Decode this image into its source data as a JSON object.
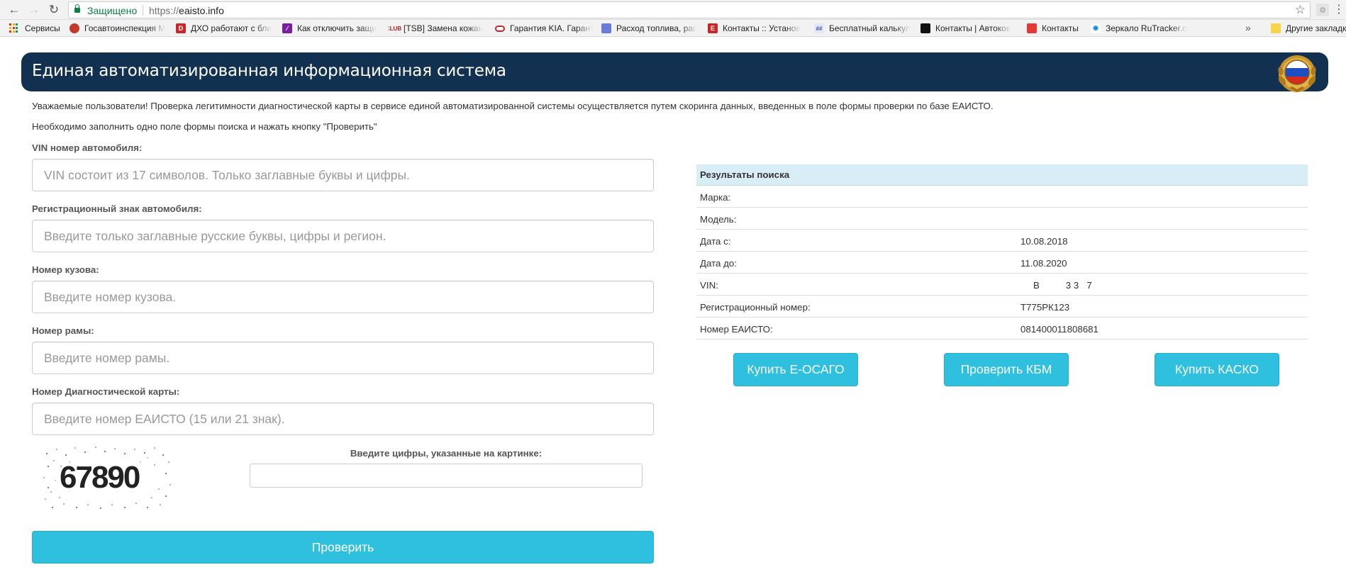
{
  "browser": {
    "secure_label": "Защищено",
    "url_scheme": "https://",
    "url_host": "eaisto.info",
    "bookmarks": [
      {
        "label": "Сервисы",
        "icon": "apps-grid-icon"
      },
      {
        "label": "Госавтоинспекция М",
        "icon": "gibdd-emblem-icon"
      },
      {
        "label": "ДХО работают с бли",
        "icon": "d-letter-icon"
      },
      {
        "label": "Как отключить защи",
        "icon": "purple-square-icon"
      },
      {
        "label": "[TSB] Замена кожан",
        "icon": "tsb-club-icon"
      },
      {
        "label": "Гарантия KIA. Гарант",
        "icon": "kia-logo-icon"
      },
      {
        "label": "Расход топлива, рас",
        "icon": "blue-doc-icon"
      },
      {
        "label": "Контакты :: Установ",
        "icon": "e-letter-icon"
      },
      {
        "label": "Бесплатный калькул",
        "icon": "calc-icon"
      },
      {
        "label": "Контакты | Автоков",
        "icon": "black-square-icon"
      },
      {
        "label": "Контакты",
        "icon": "red-logo-icon"
      },
      {
        "label": "Зеркало RuTracker.o",
        "icon": "rutracker-icon"
      },
      {
        "label": "Другие закладк",
        "icon": "folder-icon"
      }
    ]
  },
  "header": {
    "title": "Единая автоматизированная информационная система"
  },
  "notice": {
    "line1": "Уважаемые пользователи! Проверка легитимности диагностической карты в сервисе единой автоматизированной системы осуществляется путем скоринга данных, введенных в поле формы проверки по базе ЕАИСТО.",
    "line2": "Необходимо заполнить одно поле формы поиска и нажать кнопку \"Проверить\""
  },
  "form": {
    "vin_label": "VIN номер автомобиля:",
    "vin_placeholder": "VIN состоит из 17 символов. Только заглавные буквы и цифры.",
    "reg_label": "Регистрационный знак автомобиля:",
    "reg_placeholder": "Введите только заглавные русские буквы, цифры и регион.",
    "body_label": "Номер кузова:",
    "body_placeholder": "Введите номер кузова.",
    "frame_label": "Номер рамы:",
    "frame_placeholder": "Введите номер рамы.",
    "card_label": "Номер Диагностической карты:",
    "card_placeholder": "Введите номер ЕАИСТО (15 или 21 знак).",
    "captcha_code": "67890",
    "captcha_label": "Введите цифры, указанные на картинке:",
    "captcha_value": "",
    "submit_label": "Проверить"
  },
  "results": {
    "title": "Результаты поиска",
    "rows": [
      {
        "label": "Марка:",
        "value": ""
      },
      {
        "label": "Модель:",
        "value": ""
      },
      {
        "label": "Дата с:",
        "value": "10.08.2018"
      },
      {
        "label": "Дата до:",
        "value": "11.08.2020"
      },
      {
        "label": "VIN:",
        "value": "В          3 3   7"
      },
      {
        "label": "Регистрационный номер:",
        "value": "Т775РК123"
      },
      {
        "label": "Номер ЕАИСТО:",
        "value": "081400011808681"
      }
    ]
  },
  "actions": {
    "osago_label": "Купить Е-ОСАГО",
    "kbm_label": "Проверить КБМ",
    "kasko_label": "Купить КАСКО"
  },
  "colors": {
    "header_bg": "#123151",
    "button_bg": "#2fbfdf",
    "results_head_bg": "#d9edf7",
    "secure_green": "#0b8043"
  }
}
